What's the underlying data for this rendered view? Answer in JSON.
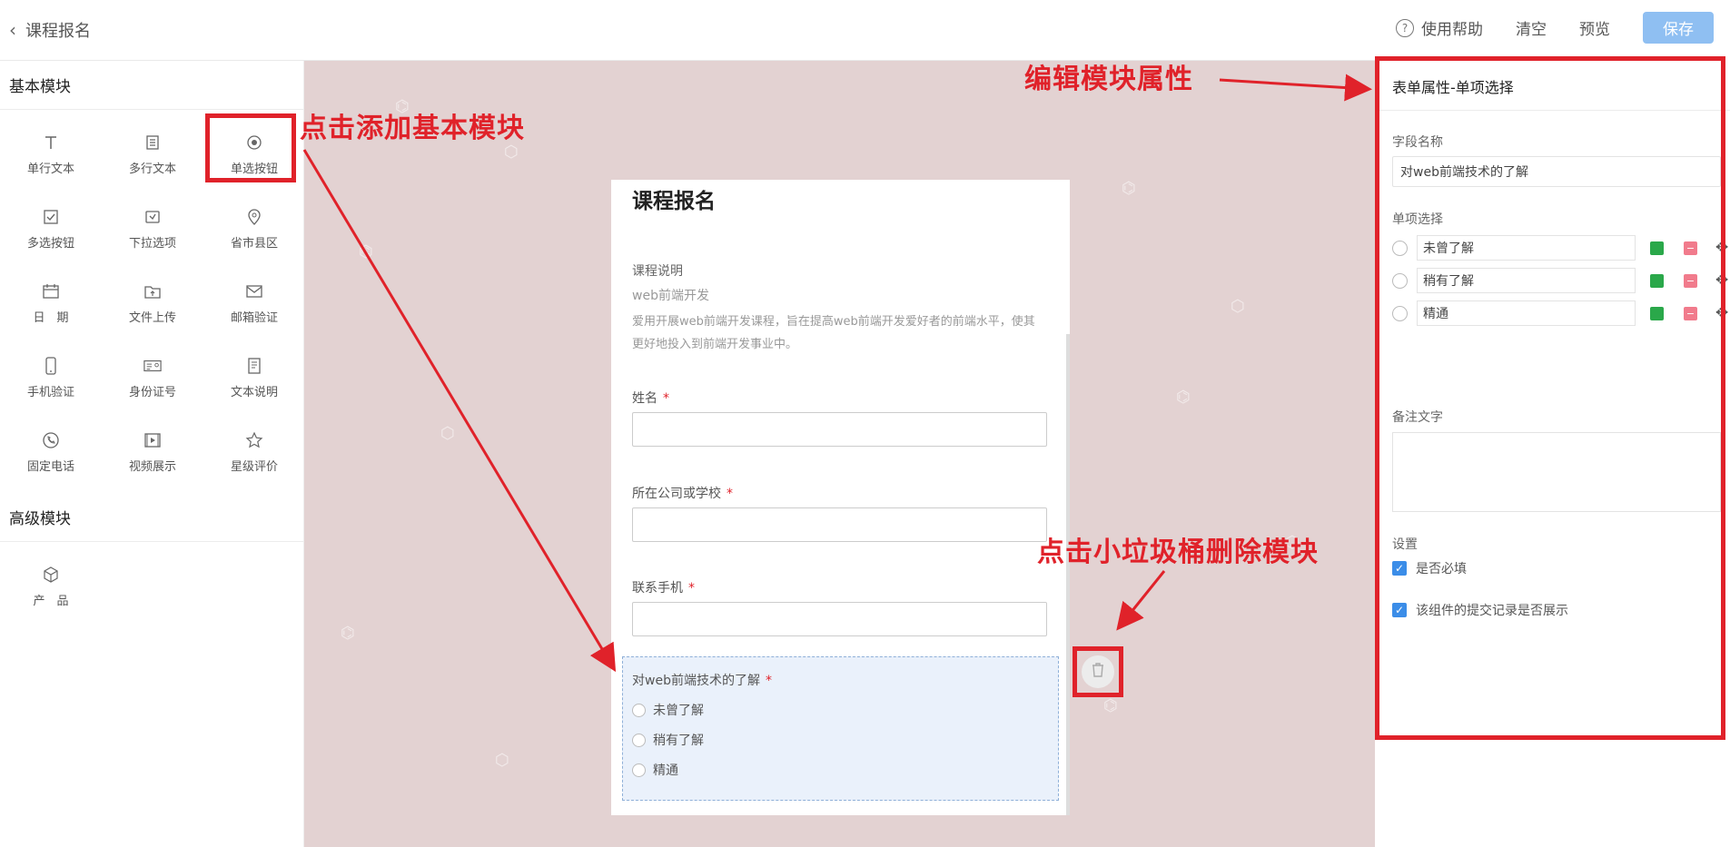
{
  "header": {
    "back_label": "课程报名",
    "help_label": "使用帮助",
    "clear_label": "清空",
    "preview_label": "预览",
    "save_label": "保存"
  },
  "sidebar": {
    "basic_title": "基本模块",
    "basic_items": [
      {
        "label": "单行文本",
        "icon": "text-icon"
      },
      {
        "label": "多行文本",
        "icon": "multiline-icon"
      },
      {
        "label": "单选按钮",
        "icon": "radio-icon"
      },
      {
        "label": "多选按钮",
        "icon": "checkbox-icon"
      },
      {
        "label": "下拉选项",
        "icon": "dropdown-icon"
      },
      {
        "label": "省市县区",
        "icon": "location-icon"
      },
      {
        "label": "日　期",
        "icon": "calendar-icon"
      },
      {
        "label": "文件上传",
        "icon": "upload-icon"
      },
      {
        "label": "邮箱验证",
        "icon": "mail-icon"
      },
      {
        "label": "手机验证",
        "icon": "phone-icon"
      },
      {
        "label": "身份证号",
        "icon": "id-card-icon"
      },
      {
        "label": "文本说明",
        "icon": "document-icon"
      },
      {
        "label": "固定电话",
        "icon": "telephone-icon"
      },
      {
        "label": "视频展示",
        "icon": "video-icon"
      },
      {
        "label": "星级评价",
        "icon": "star-icon"
      }
    ],
    "advanced_title": "高级模块",
    "advanced_items": [
      {
        "label": "产　品",
        "icon": "cube-icon"
      }
    ]
  },
  "form": {
    "title": "课程报名",
    "desc_label": "课程说明",
    "desc_subtitle": "web前端开发",
    "desc_text": "爱用开展web前端开发课程，旨在提高web前端开发爱好者的前端水平，使其更好地投入到前端开发事业中。",
    "fields": [
      {
        "label": "姓名",
        "required": "*"
      },
      {
        "label": "所在公司或学校",
        "required": "*"
      },
      {
        "label": "联系手机",
        "required": "*"
      }
    ],
    "selected_field": {
      "label": "对web前端技术的了解",
      "required": "*",
      "options": [
        "未曾了解",
        "稍有了解",
        "精通"
      ]
    }
  },
  "properties": {
    "title": "表单属性-单项选择",
    "field_name_label": "字段名称",
    "field_name_value": "对web前端技术的了解",
    "options_label": "单项选择",
    "options": [
      "未曾了解",
      "稍有了解",
      "精通"
    ],
    "note_label": "备注文字",
    "settings_label": "设置",
    "required_label": "是否必填",
    "show_records_label": "该组件的提交记录是否展示"
  },
  "annotations": {
    "add_module": "点击添加基本模块",
    "edit_props": "编辑模块属性",
    "delete_module": "点击小垃圾桶删除模块"
  },
  "colors": {
    "accent": "#e0222a",
    "save_button": "#8fbff2",
    "canvas_bg": "#e3d2d2",
    "selected_block": "#eaf1fb"
  }
}
